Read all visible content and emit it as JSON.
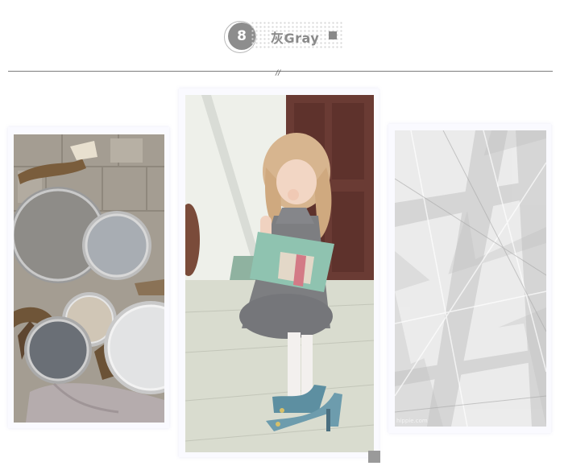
{
  "header": {
    "number": "8",
    "title": "灰Gray",
    "accent_color": "#8d8d8d"
  },
  "images": [
    {
      "name": "gray-paint-cans-photo",
      "description_icon": "image-icon"
    },
    {
      "name": "girl-with-book-photo",
      "description_icon": "image-icon"
    },
    {
      "name": "gray-abstract-texture",
      "description_icon": "image-icon",
      "watermark": "hippie.com"
    }
  ],
  "colors": {
    "divider": "#7d7d7d",
    "frame": "#fafaff"
  }
}
